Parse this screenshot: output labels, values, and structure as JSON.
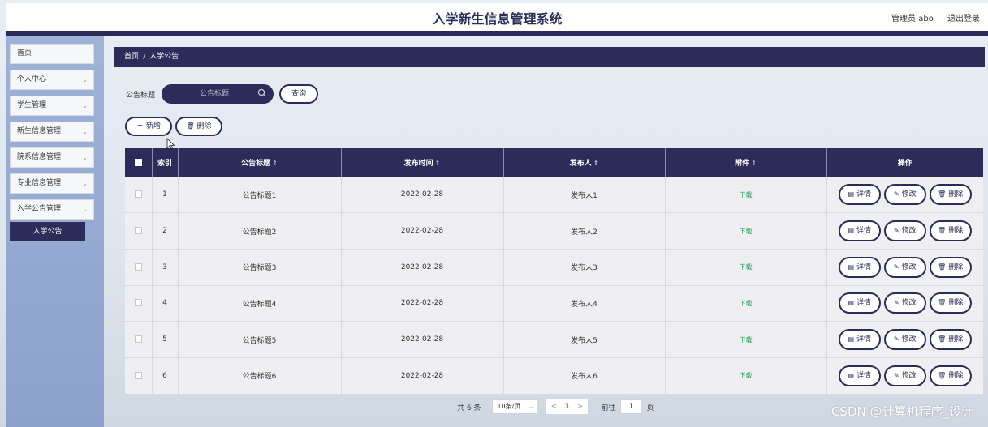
{
  "header": {
    "title": "入学新生信息管理系统",
    "user_label": "管理员 abo",
    "logout_label": "退出登录"
  },
  "sidebar": {
    "items": [
      {
        "label": "首页",
        "has_chevron": false
      },
      {
        "label": "个人中心",
        "has_chevron": true
      },
      {
        "label": "学生管理",
        "has_chevron": true
      },
      {
        "label": "新生信息管理",
        "has_chevron": true
      },
      {
        "label": "院系信息管理",
        "has_chevron": true
      },
      {
        "label": "专业信息管理",
        "has_chevron": true
      },
      {
        "label": "入学公告管理",
        "has_chevron": true
      }
    ],
    "active_subitem": "入学公告"
  },
  "breadcrumb": {
    "home": "首页",
    "separator": "/",
    "current": "入学公告"
  },
  "search": {
    "label": "公告标题",
    "placeholder": "公告标题",
    "query_button": "查询"
  },
  "toolbar": {
    "add_label": "新增",
    "delete_label": "删除"
  },
  "table": {
    "columns": [
      "索引",
      "公告标题",
      "发布时间",
      "发布人",
      "附件",
      "操作"
    ],
    "rows": [
      {
        "index": "1",
        "title": "公告标题1",
        "date": "2022-02-28",
        "publisher": "发布人1",
        "attachment": "下载"
      },
      {
        "index": "2",
        "title": "公告标题2",
        "date": "2022-02-28",
        "publisher": "发布人2",
        "attachment": "下载"
      },
      {
        "index": "3",
        "title": "公告标题3",
        "date": "2022-02-28",
        "publisher": "发布人3",
        "attachment": "下载"
      },
      {
        "index": "4",
        "title": "公告标题4",
        "date": "2022-02-28",
        "publisher": "发布人4",
        "attachment": "下载"
      },
      {
        "index": "5",
        "title": "公告标题5",
        "date": "2022-02-28",
        "publisher": "发布人5",
        "attachment": "下载"
      },
      {
        "index": "6",
        "title": "公告标题6",
        "date": "2022-02-28",
        "publisher": "发布人6",
        "attachment": "下载"
      }
    ],
    "actions": {
      "detail": "详情",
      "edit": "修改",
      "delete": "删除"
    }
  },
  "pagination": {
    "total": "共 6 条",
    "page_size": "10条/页",
    "prev": "<",
    "current_page": "1",
    "next": ">",
    "goto_label": "前往",
    "goto_value": "1",
    "page_unit": "页"
  },
  "watermark": "CSDN @计算机程序_设计",
  "colors": {
    "primary": "#2b2c59",
    "sidebar": "#8ba1cc",
    "download": "#27a35a",
    "row_bg": "#efeff2"
  }
}
